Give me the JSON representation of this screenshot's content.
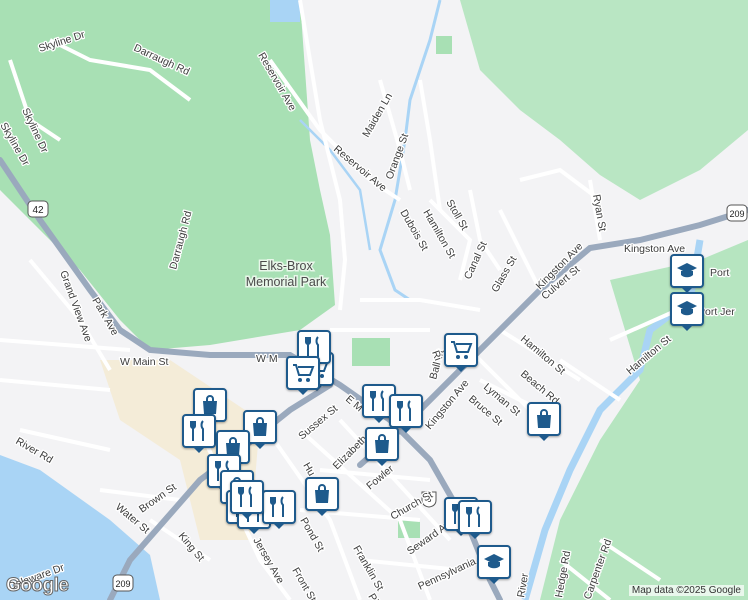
{
  "map": {
    "park_name_line1": "Elks-Brox",
    "park_name_line2": "Memorial Park",
    "attribution": "Map data ©2025 Google",
    "logo": "Google",
    "routes": [
      "42",
      "209",
      "6",
      "209"
    ],
    "colors": {
      "background": "#f3f3f5",
      "park": "#a8e0b4",
      "water": "#a9d4f5",
      "highway": "#9aa9bd",
      "marker": "#1e5a8c",
      "town_area": "#f4ecd8"
    }
  },
  "streets": [
    "Skyline Dr",
    "Darraugh Rd",
    "Skyline Dr",
    "Skyline Dr",
    "Reservoir Ave",
    "Maiden Ln",
    "Reservoir Ave",
    "Orange St",
    "Stoll St",
    "Hamilton St",
    "Dubois St",
    "Canal St",
    "Glass St",
    "Ryan St",
    "Kingston Ave",
    "Kingston Ave",
    "Culvert St",
    "Darraugh Rd",
    "Park Ave",
    "Grand View Ave",
    "W Main St",
    "W M",
    "Sussex St",
    "E M",
    "Elizabeth",
    "Kingston Ave",
    "Fowler",
    "Lyman St",
    "Bruce St",
    "Beach Rd",
    "Hamilton St",
    "Hamilton St",
    "River Rd",
    "Water St",
    "Brown St",
    "King St",
    "Jersey Ave",
    "Front St",
    "Church St",
    "Seward Ave",
    "Franklin St",
    "Delaware Dr",
    "Pennsylvania Ave",
    "Carpenter Rd",
    "Hedge Rd",
    "River",
    "Ri",
    "Pike",
    "Hu",
    "Pond St",
    "Ball St"
  ],
  "places": [
    "Port",
    "Port Jer"
  ],
  "markers": [
    {
      "type": "shopping-cart"
    },
    {
      "type": "restaurant"
    },
    {
      "type": "shopping-cart"
    },
    {
      "type": "shopping-bag"
    },
    {
      "type": "restaurant"
    },
    {
      "type": "shopping-bag"
    },
    {
      "type": "shopping-bag"
    },
    {
      "type": "restaurant"
    },
    {
      "type": "restaurant"
    },
    {
      "type": "shopping-bag"
    },
    {
      "type": "shopping-cart"
    },
    {
      "type": "restaurant"
    },
    {
      "type": "shopping-bag"
    },
    {
      "type": "shopping-bag"
    },
    {
      "type": "restaurant"
    },
    {
      "type": "restaurant"
    },
    {
      "type": "restaurant"
    },
    {
      "type": "restaurant"
    },
    {
      "type": "shopping-bag"
    },
    {
      "type": "school"
    },
    {
      "type": "school"
    },
    {
      "type": "school"
    },
    {
      "type": "restaurant"
    },
    {
      "type": "restaurant"
    }
  ]
}
